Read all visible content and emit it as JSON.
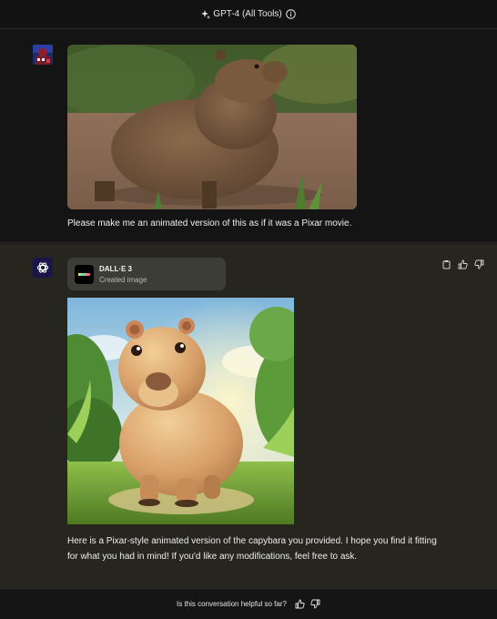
{
  "header": {
    "model_label": "GPT-4 (All Tools)",
    "sparkle_icon": "sparkle-icon",
    "info_icon": "info-icon"
  },
  "conversation": {
    "user_message": {
      "avatar": "user-avatar",
      "image": "capybara-photo",
      "text": "Please make me an animated version of this as if it was a Pixar movie."
    },
    "assistant_message": {
      "avatar": "openai-logo-icon",
      "tool": {
        "name": "DALL·E 3",
        "status": "Created image"
      },
      "image": "pixar-capybara-image",
      "text_line1": "Here is a Pixar-style animated version of the capybara you provided. I hope you find it fitting",
      "text_line2": "for what you had in mind! If you'd like any modifications, feel free to ask.",
      "actions": [
        "copy-icon",
        "thumbs-up-icon",
        "thumbs-down-icon"
      ]
    }
  },
  "footer": {
    "prompt": "Is this conversation helpful so far?",
    "icons": [
      "thumbs-up-icon",
      "thumbs-down-icon"
    ]
  }
}
